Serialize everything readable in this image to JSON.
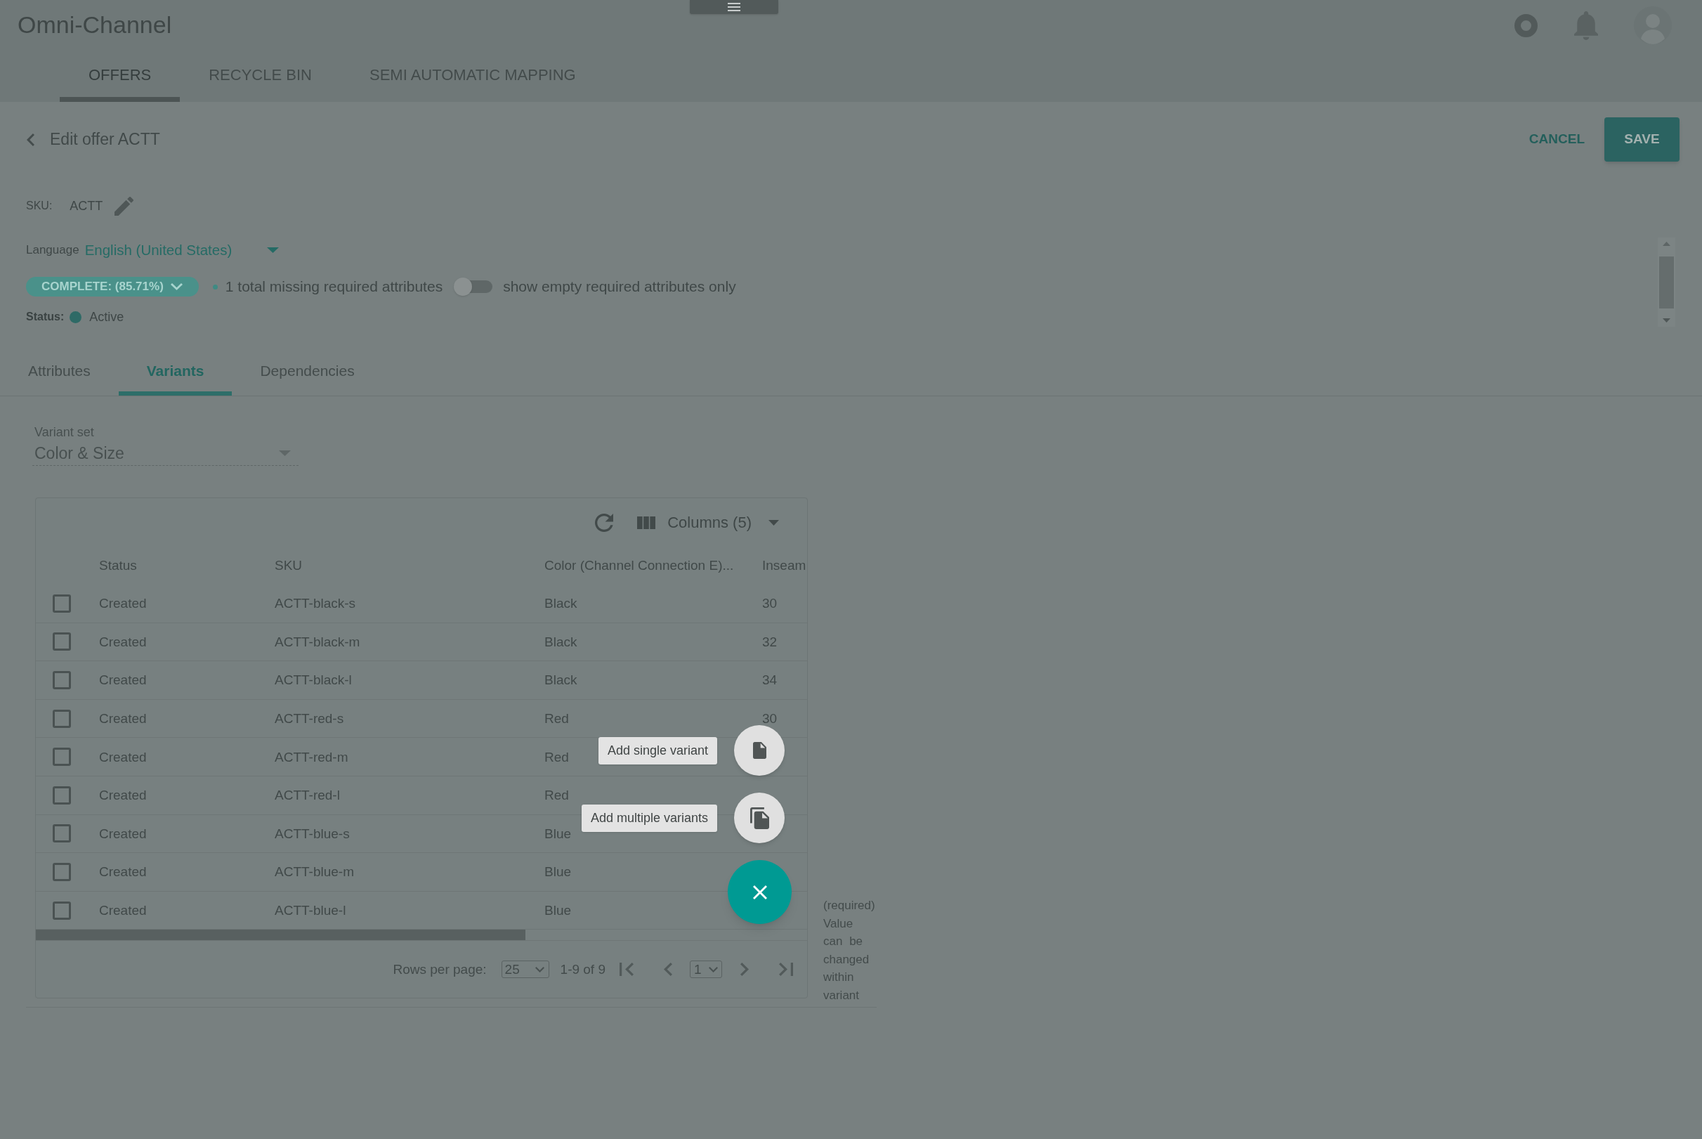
{
  "app": {
    "title": "Omni-Channel"
  },
  "nav_tabs": [
    {
      "label": "OFFERS",
      "selected": true
    },
    {
      "label": "RECYCLE BIN",
      "selected": false
    },
    {
      "label": "SEMI AUTOMATIC MAPPING",
      "selected": false
    }
  ],
  "page": {
    "title": "Edit offer ACTT",
    "actions": [
      {
        "label": "CANCEL",
        "kind": "text"
      },
      {
        "label": "SAVE",
        "kind": "contained"
      }
    ]
  },
  "details": {
    "sku": {
      "label": "SKU:",
      "value": "ACTT"
    },
    "language": {
      "label": "Language",
      "value": "English (United States)"
    },
    "completeness": {
      "label": "COMPLETE: (85.71%)",
      "missing": "1 total missing required attributes"
    },
    "empty_only_toggle": {
      "label": "show empty required attributes only",
      "on": false
    },
    "status": {
      "label": "Status:",
      "value": "Active"
    }
  },
  "tabs": [
    {
      "label": "Attributes",
      "selected": false
    },
    {
      "label": "Variants",
      "selected": true
    },
    {
      "label": "Dependencies",
      "selected": false
    }
  ],
  "variant_set": {
    "label": "Variant set",
    "value": "Color & Size",
    "disabled": true
  },
  "table": {
    "columns_button": "Columns (5)",
    "columns": [
      "Status",
      "SKU",
      "Color (Channel Connection E)...",
      "Inseam"
    ],
    "rows": [
      {
        "checked": false,
        "cells": [
          "Created",
          "ACTT-black-s",
          "Black",
          "30"
        ]
      },
      {
        "checked": false,
        "cells": [
          "Created",
          "ACTT-black-m",
          "Black",
          "32"
        ]
      },
      {
        "checked": false,
        "cells": [
          "Created",
          "ACTT-black-l",
          "Black",
          "34"
        ]
      },
      {
        "checked": false,
        "cells": [
          "Created",
          "ACTT-red-s",
          "Red",
          "30"
        ]
      },
      {
        "checked": false,
        "cells": [
          "Created",
          "ACTT-red-m",
          "Red"
        ]
      },
      {
        "checked": false,
        "cells": [
          "Created",
          "ACTT-red-l",
          "Red"
        ]
      },
      {
        "checked": false,
        "cells": [
          "Created",
          "ACTT-blue-s",
          "Blue"
        ]
      },
      {
        "checked": false,
        "cells": [
          "Created",
          "ACTT-blue-m",
          "Blue"
        ]
      },
      {
        "checked": false,
        "cells": [
          "Created",
          "ACTT-blue-l",
          "Blue"
        ]
      }
    ],
    "pagination": {
      "rows_per_page_label": "Rows per page:",
      "rows_per_page": "25",
      "range": "1-9 of 9",
      "page": "1"
    }
  },
  "hint": "(required) Value can be changed within variant",
  "speed_dial": {
    "open": true,
    "actions": [
      {
        "kind": "single",
        "tooltip": "Add single variant"
      },
      {
        "kind": "multiple",
        "tooltip": "Add multiple variants"
      }
    ]
  }
}
